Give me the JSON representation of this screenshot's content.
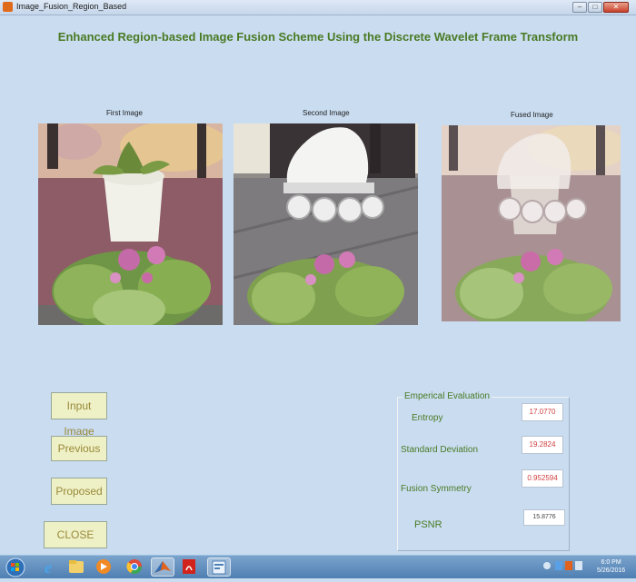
{
  "window": {
    "title": "Image_Fusion_Region_Based"
  },
  "main": {
    "title": "Enhanced Region-based Image Fusion Scheme Using the Discrete Wavelet Frame Transform"
  },
  "images": {
    "first_caption": "First Image",
    "second_caption": "Second Image",
    "fused_caption": "Fused Image"
  },
  "buttons": {
    "input_image": "Input Image",
    "previous": "Previous",
    "proposed": "Proposed",
    "close": "CLOSE"
  },
  "evaluation": {
    "title": "Emperical Evaluation",
    "entropy_label": "Entropy",
    "entropy_value": "17.0770",
    "std_label": "Standard Deviation",
    "std_value": "19.2824",
    "symmetry_label": "Fusion Symmetry",
    "symmetry_value": "0.952594",
    "psnr_label": "PSNR",
    "psnr_value": "15.8776"
  },
  "taskbar": {
    "items": [
      "start-orb",
      "ie-icon",
      "explorer-icon",
      "media-player-icon",
      "chrome-icon",
      "matlab-icon",
      "acrobat-icon",
      "app-window-icon"
    ],
    "clock_time": "6:0 PM",
    "clock_date": "5/26/2016"
  }
}
